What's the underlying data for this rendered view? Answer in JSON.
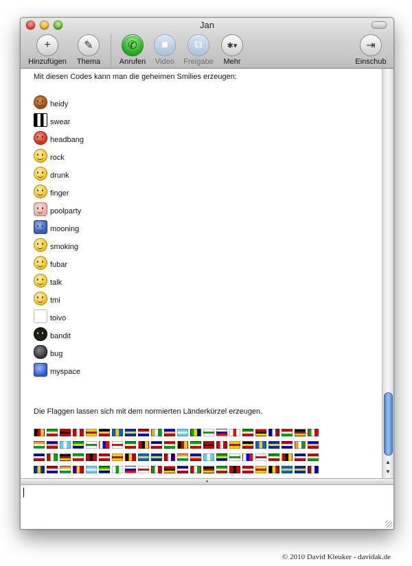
{
  "window": {
    "title": "Jan"
  },
  "toolbar": {
    "buttons": [
      {
        "label": "Hinzufügen",
        "icon": "plus-icon",
        "glyph": "+",
        "enabled": true
      },
      {
        "label": "Thema",
        "icon": "pencil-icon",
        "glyph": "✎",
        "enabled": true
      },
      {
        "label": "Anrufen",
        "icon": "phone-icon",
        "glyph": "✆",
        "enabled": true
      },
      {
        "label": "Video",
        "icon": "video-camera-icon",
        "glyph": "■",
        "enabled": false
      },
      {
        "label": "Freigabe",
        "icon": "screen-share-icon",
        "glyph": "⧉",
        "enabled": false
      },
      {
        "label": "Mehr",
        "icon": "gear-icon",
        "glyph": "✱▾",
        "enabled": true
      },
      {
        "label": "Einschub",
        "icon": "drawer-icon",
        "glyph": "⇥",
        "enabled": true
      }
    ]
  },
  "chat": {
    "intro": "Mit diesen Codes kann man die geheimen Smilies erzeugen:",
    "smilies": [
      {
        "code": "heidy",
        "icon": "squirrel-icon"
      },
      {
        "code": "swear",
        "icon": "swear-icon"
      },
      {
        "code": "headbang",
        "icon": "headbang-icon"
      },
      {
        "code": "rock",
        "icon": "rock-icon"
      },
      {
        "code": "drunk",
        "icon": "drunk-icon"
      },
      {
        "code": "finger",
        "icon": "finger-icon"
      },
      {
        "code": "poolparty",
        "icon": "poolparty-icon"
      },
      {
        "code": "mooning",
        "icon": "mooning-icon"
      },
      {
        "code": "smoking",
        "icon": "smoking-icon"
      },
      {
        "code": "fubar",
        "icon": "fubar-icon"
      },
      {
        "code": "talk",
        "icon": "talk-icon"
      },
      {
        "code": "tmi",
        "icon": "tmi-icon"
      },
      {
        "code": "toivo",
        "icon": "toivo-icon"
      },
      {
        "code": "bandit",
        "icon": "bandit-icon"
      },
      {
        "code": "bug",
        "icon": "bug-icon"
      },
      {
        "code": "myspace",
        "icon": "myspace-icon"
      }
    ],
    "flags_text": "Die Flaggen lassen sich mit dem normierten Länderkürzel erzeugen.",
    "flag_rows": [
      22,
      22,
      22,
      22,
      20
    ]
  },
  "input": {
    "value": ""
  },
  "footer": {
    "copyright": "© 2010 David Kleuker - davidak.de"
  },
  "colors": {
    "accent": "#4a86d8",
    "call_green": "#2fb12a"
  }
}
